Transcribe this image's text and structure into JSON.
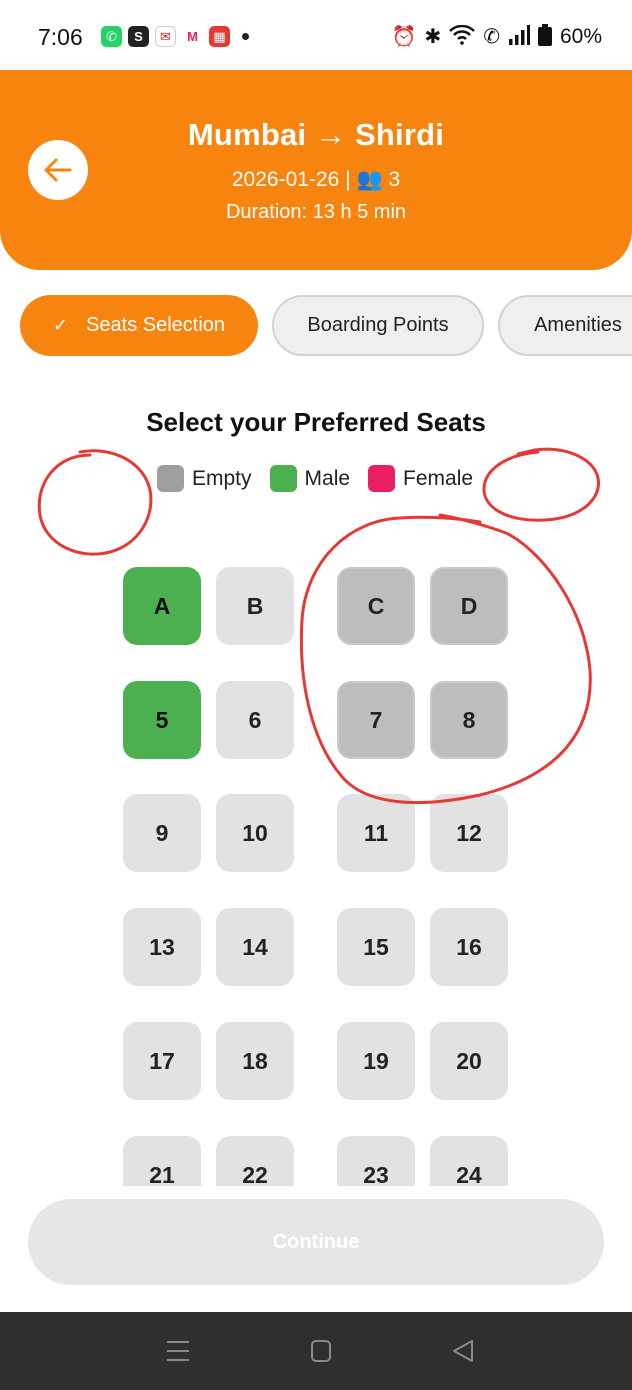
{
  "status_bar": {
    "time": "7:06",
    "battery": "60%",
    "notification_icons": [
      "whatsapp-icon",
      "s-app-icon",
      "gmail-like-icon",
      "myntra-icon",
      "calendar-app-icon"
    ]
  },
  "header": {
    "title": "Mumbai → Shirdi",
    "date": "2026-01-26",
    "passenger_count": "3",
    "duration": "Duration: 13 h 5 min"
  },
  "tabs": [
    {
      "label": "Seats Selection",
      "active": true
    },
    {
      "label": "Boarding Points",
      "active": false
    },
    {
      "label": "Amenities",
      "active": false
    }
  ],
  "section": {
    "title": "Select your Preferred Seats"
  },
  "legend": [
    {
      "label": "Empty",
      "color": "#9e9e9e"
    },
    {
      "label": "Male",
      "color": "#4caf50"
    },
    {
      "label": "Female",
      "color": "#e91e63"
    }
  ],
  "seats": [
    {
      "label": "A",
      "status": "male"
    },
    {
      "label": "B",
      "status": "empty"
    },
    {
      "label": "C",
      "status": "empty"
    },
    {
      "label": "D",
      "status": "empty"
    },
    {
      "label": "5",
      "status": "male"
    },
    {
      "label": "6",
      "status": "empty"
    },
    {
      "label": "7",
      "status": "empty"
    },
    {
      "label": "8",
      "status": "empty"
    },
    {
      "label": "9",
      "status": "empty"
    },
    {
      "label": "10",
      "status": "empty"
    },
    {
      "label": "11",
      "status": "empty"
    },
    {
      "label": "12",
      "status": "empty"
    },
    {
      "label": "13",
      "status": "empty"
    },
    {
      "label": "14",
      "status": "empty"
    },
    {
      "label": "15",
      "status": "empty"
    },
    {
      "label": "16",
      "status": "empty"
    },
    {
      "label": "17",
      "status": "empty"
    },
    {
      "label": "18",
      "status": "empty"
    },
    {
      "label": "19",
      "status": "empty"
    },
    {
      "label": "20",
      "status": "empty"
    },
    {
      "label": "21",
      "status": "empty"
    },
    {
      "label": "22",
      "status": "empty"
    },
    {
      "label": "23",
      "status": "empty"
    },
    {
      "label": "24",
      "status": "empty"
    }
  ],
  "actions": {
    "continue_label": "Continue"
  },
  "colors": {
    "accent": "#f7840f",
    "male": "#4caf50",
    "female": "#e91e63",
    "empty": "#9e9e9e",
    "annotation": "#e53935"
  }
}
